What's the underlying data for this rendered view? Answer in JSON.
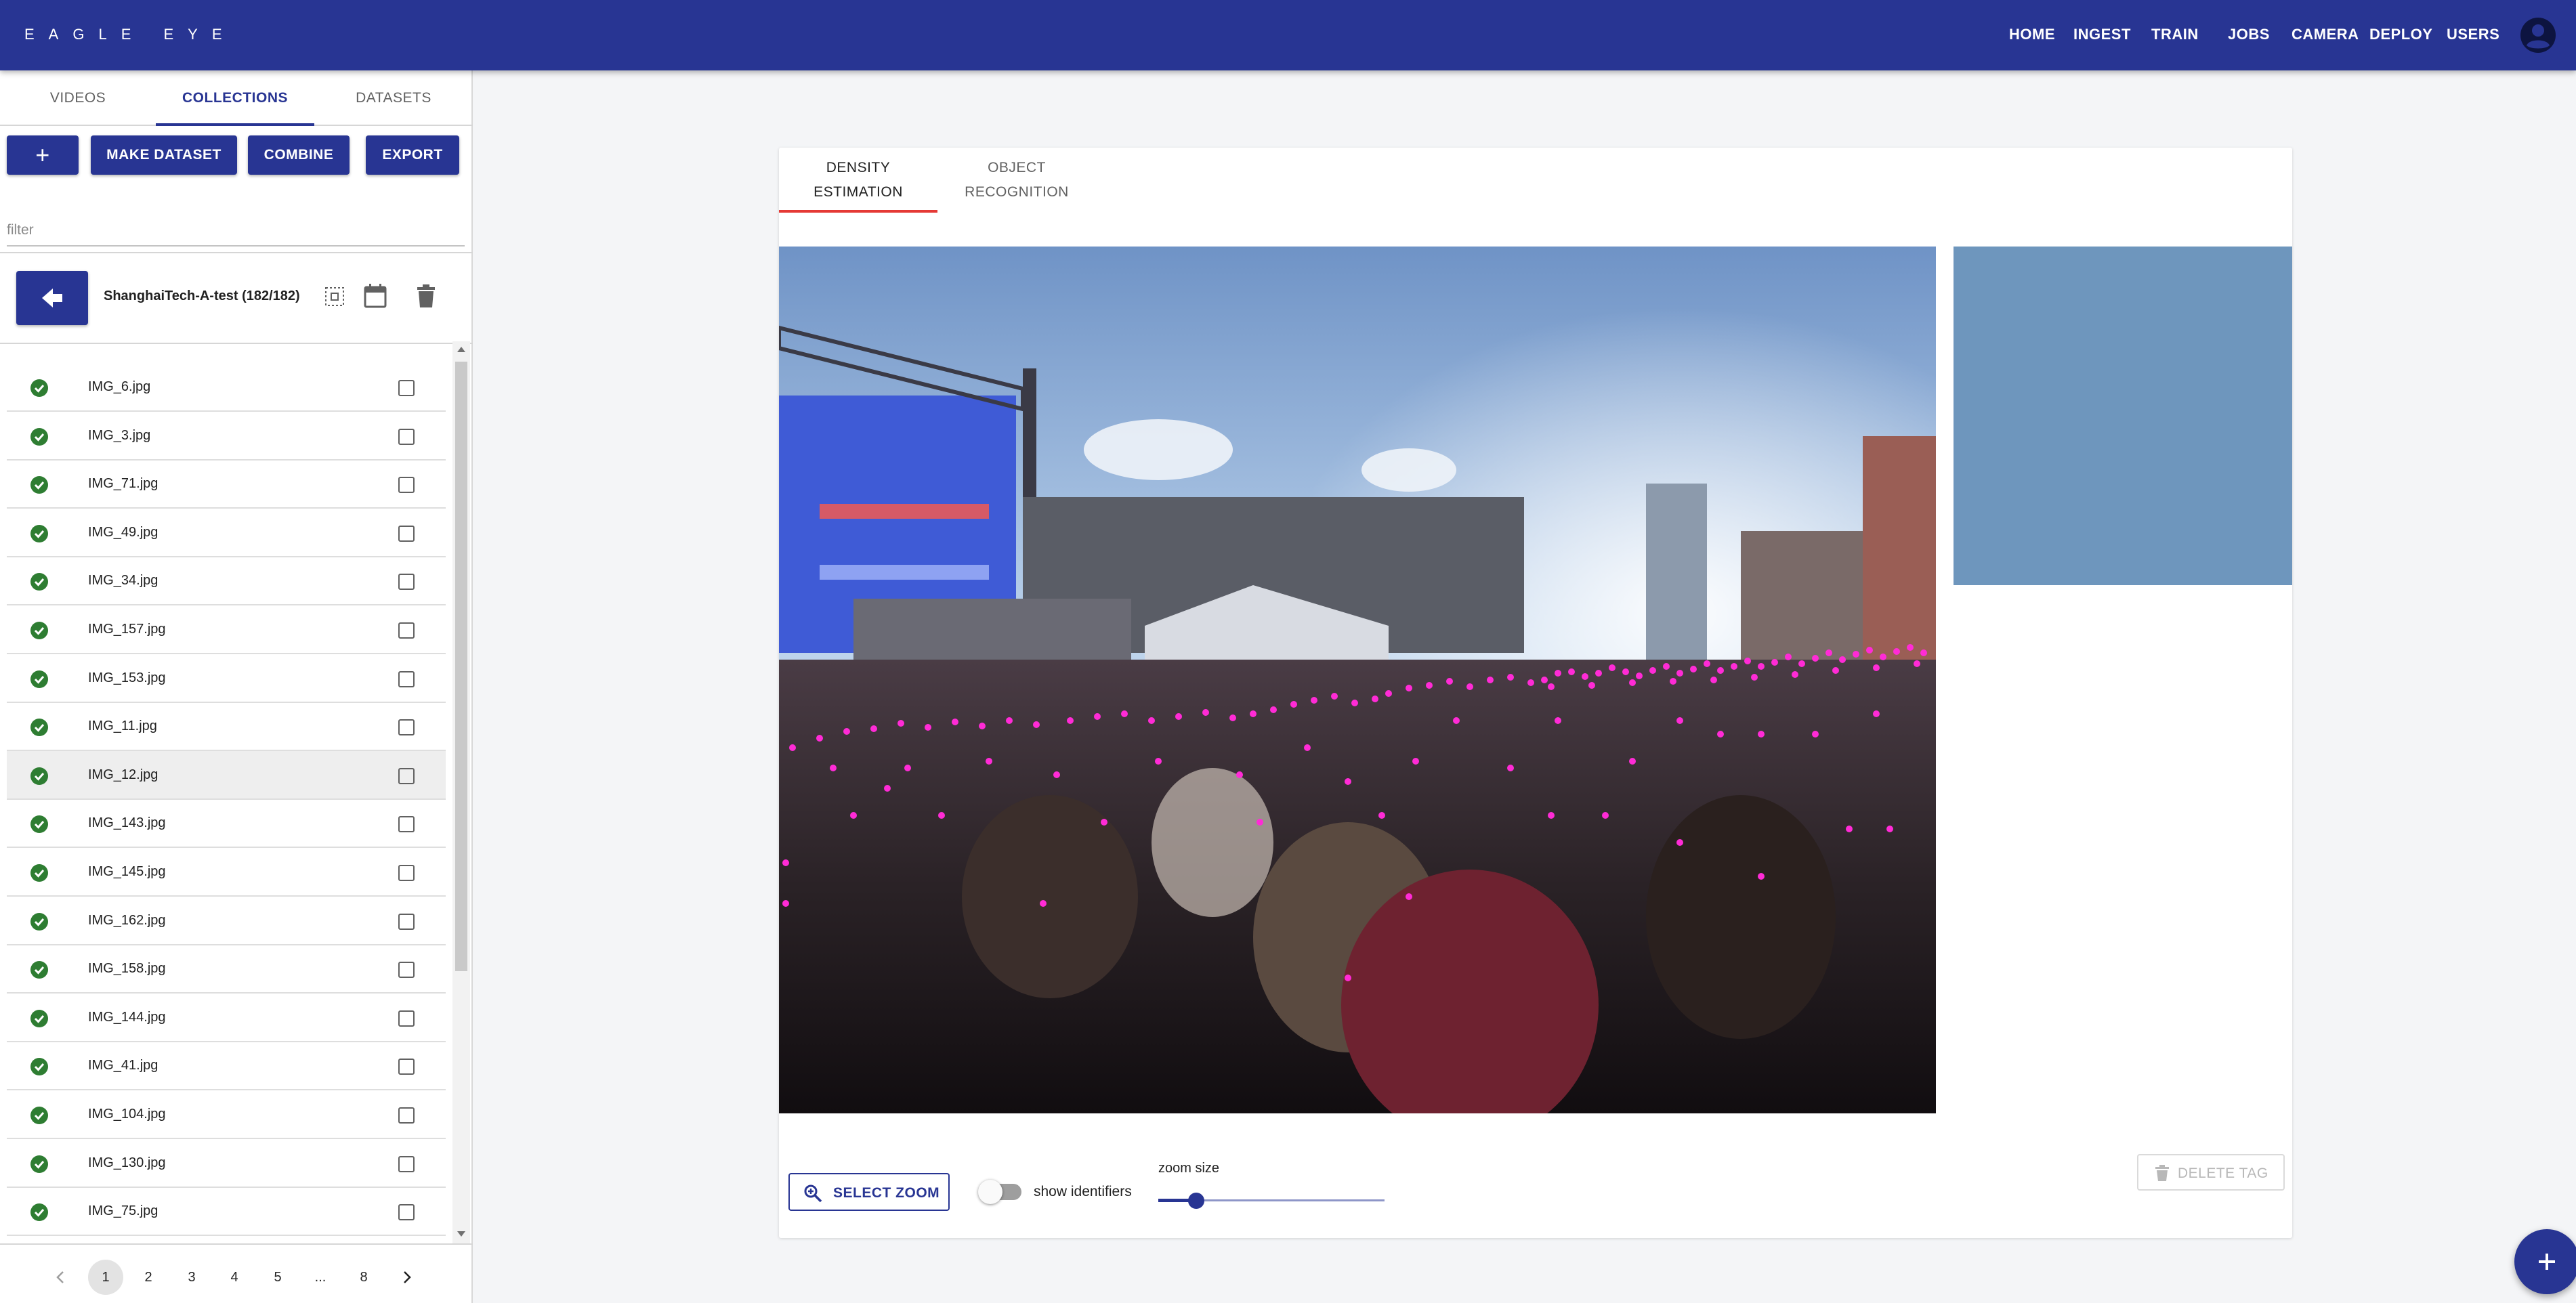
{
  "app": {
    "brand": "EAGLE EYE"
  },
  "nav": {
    "items": [
      "HOME",
      "INGEST",
      "TRAIN",
      "JOBS",
      "CAMERA",
      "DEPLOY",
      "USERS"
    ]
  },
  "sidebar": {
    "tabs": [
      "VIDEOS",
      "COLLECTIONS",
      "DATASETS"
    ],
    "active_tab": "COLLECTIONS",
    "actions": {
      "add": "+",
      "make_dataset": "MAKE DATASET",
      "combine": "COMBINE",
      "export": "EXPORT"
    },
    "filter_placeholder": "filter",
    "collection_title": "ShanghaiTech-A-test (182/182)",
    "files": [
      "IMG_6.jpg",
      "IMG_3.jpg",
      "IMG_71.jpg",
      "IMG_49.jpg",
      "IMG_34.jpg",
      "IMG_157.jpg",
      "IMG_153.jpg",
      "IMG_11.jpg",
      "IMG_12.jpg",
      "IMG_143.jpg",
      "IMG_145.jpg",
      "IMG_162.jpg",
      "IMG_158.jpg",
      "IMG_144.jpg",
      "IMG_41.jpg",
      "IMG_104.jpg",
      "IMG_130.jpg",
      "IMG_75.jpg"
    ],
    "selected_file": "IMG_12.jpg",
    "pagination": {
      "pages": [
        "1",
        "2",
        "3",
        "4",
        "5",
        "...",
        "8"
      ],
      "current": "1"
    }
  },
  "main": {
    "tabs": [
      {
        "line1": "DENSITY",
        "line2": "ESTIMATION"
      },
      {
        "line1": "OBJECT",
        "line2": "RECOGNITION"
      }
    ],
    "active_tab": "DENSITY ESTIMATION",
    "select_zoom": "SELECT ZOOM",
    "show_identifiers": {
      "label": "show identifiers",
      "on": false
    },
    "zoom_size": {
      "label": "zoom size",
      "value": 0.17
    },
    "delete_tag": "DELETE TAG"
  },
  "colors": {
    "primary": "#283593",
    "annotation": "#ff2bd6",
    "success": "#2e7d32",
    "tab_indicator": "#e53935",
    "preview": "#6e96bd"
  }
}
